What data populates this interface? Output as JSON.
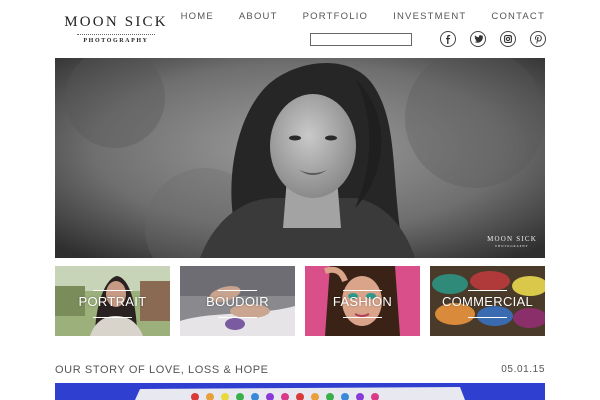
{
  "brand": {
    "name": "MOON SICK",
    "tagline": "PHOTOGRAPHY"
  },
  "nav": [
    "HOME",
    "ABOUT",
    "PORTFOLIO",
    "INVESTMENT",
    "CONTACT"
  ],
  "search": {
    "value": "",
    "placeholder": ""
  },
  "social": [
    "facebook-icon",
    "twitter-icon",
    "instagram-icon",
    "pinterest-icon"
  ],
  "hero": {
    "watermark": "MOON SICK",
    "watermark_sub": "PHOTOGRAPHY"
  },
  "categories": [
    "PORTRAIT",
    "BOUDOIR",
    "FASHION",
    "COMMERCIAL"
  ],
  "post": {
    "title": "OUR STORY OF LOVE, LOSS & HOPE",
    "date": "05.01.15"
  },
  "colors": {
    "text": "#555555",
    "accent_blue": "#2f3fd0"
  }
}
